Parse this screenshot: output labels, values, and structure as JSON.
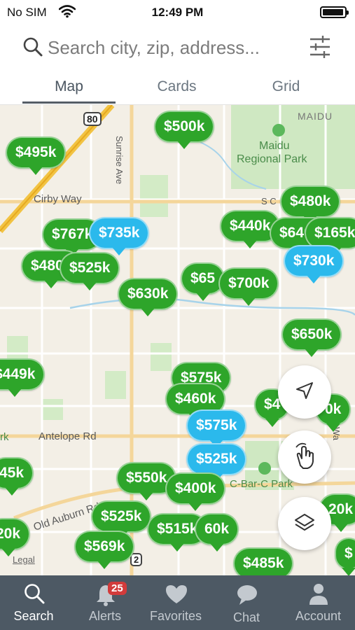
{
  "status_bar": {
    "carrier": "No SIM",
    "time": "12:49 PM"
  },
  "search": {
    "placeholder": "Search city, zip, address..."
  },
  "tabs": [
    {
      "label": "Map",
      "active": true
    },
    {
      "label": "Cards",
      "active": false
    },
    {
      "label": "Grid",
      "active": false
    }
  ],
  "map": {
    "labels": {
      "highway": "80",
      "highway2": "2",
      "maidu": "MAIDU",
      "park1": "Maidu Regional Park",
      "park1_line1": "Maidu",
      "park1_line2": "Regional Park",
      "cirby": "Cirby Way",
      "sunrise": "Sunrise Ave",
      "antelope": "Antelope Rd",
      "auburn": "Old Auburn Rd",
      "cbarc": "C-Bar-C Park",
      "legal": "Legal",
      "rk": "rk",
      "sc": "S C",
      "wa": "Wa"
    },
    "pins": [
      {
        "price": "$500k",
        "color": "green"
      },
      {
        "price": "$495k",
        "color": "green"
      },
      {
        "price": "$480k",
        "color": "green"
      },
      {
        "price": "$440k",
        "color": "green"
      },
      {
        "price": "$640k",
        "color": "green"
      },
      {
        "price": "$165k",
        "color": "green"
      },
      {
        "price": "$767k",
        "color": "green"
      },
      {
        "price": "$735k",
        "color": "blue"
      },
      {
        "price": "$480k",
        "color": "green"
      },
      {
        "price": "$525k",
        "color": "green"
      },
      {
        "price": "$730k",
        "color": "blue"
      },
      {
        "price": "$65",
        "color": "green"
      },
      {
        "price": "$700k",
        "color": "green"
      },
      {
        "price": "$630k",
        "color": "green"
      },
      {
        "price": "$650k",
        "color": "green"
      },
      {
        "price": "$449k",
        "color": "green"
      },
      {
        "price": "$575k",
        "color": "green"
      },
      {
        "price": "$460k",
        "color": "green"
      },
      {
        "price": "$4",
        "color": "green"
      },
      {
        "price": "0k",
        "color": "green"
      },
      {
        "price": "$575k",
        "color": "blue"
      },
      {
        "price": "$525k",
        "color": "blue"
      },
      {
        "price": "45k",
        "color": "green"
      },
      {
        "price": "$550k",
        "color": "green"
      },
      {
        "price": "$400k",
        "color": "green"
      },
      {
        "price": "20k",
        "color": "green"
      },
      {
        "price": "$525k",
        "color": "green"
      },
      {
        "price": "$515k",
        "color": "green"
      },
      {
        "price": "60k",
        "color": "green"
      },
      {
        "price": "20k",
        "color": "green"
      },
      {
        "price": "$569k",
        "color": "green"
      },
      {
        "price": "$485k",
        "color": "green"
      },
      {
        "price": "$",
        "color": "green"
      }
    ],
    "colors": {
      "green": "#2ea52a",
      "blue": "#2bb9ec"
    }
  },
  "map_controls": [
    "location-arrow-icon",
    "hand-draw-icon",
    "layers-icon"
  ],
  "bottom_nav": [
    {
      "label": "Search",
      "icon": "search-icon",
      "active": true
    },
    {
      "label": "Alerts",
      "icon": "bell-icon",
      "badge": "25",
      "active": false
    },
    {
      "label": "Favorites",
      "icon": "heart-icon",
      "active": false
    },
    {
      "label": "Chat",
      "icon": "chat-bubble-icon",
      "active": false
    },
    {
      "label": "Account",
      "icon": "person-icon",
      "active": false
    }
  ]
}
